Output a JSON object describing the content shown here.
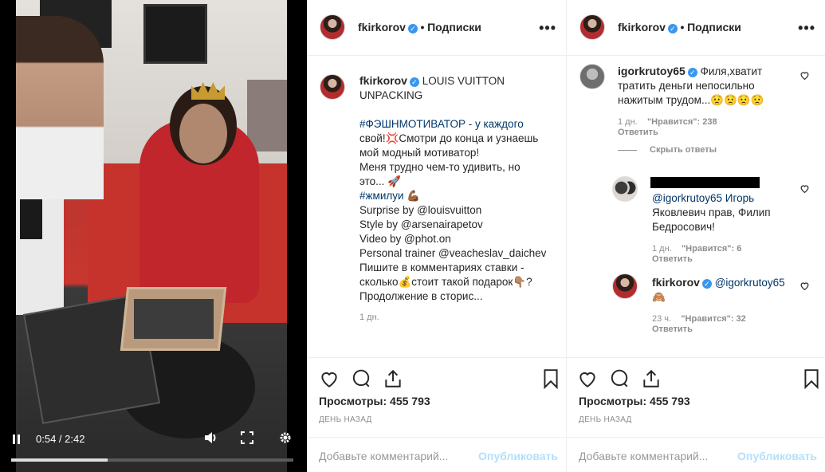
{
  "video": {
    "time": "0:54 / 2:42",
    "progress_fraction": 0.343,
    "icons": [
      "pause-icon",
      "volume-icon",
      "fullscreen-icon",
      "settings-icon"
    ]
  },
  "post_left": {
    "username": "fkirkorov",
    "follow_label": "Подписки",
    "dot": "•",
    "more": "•••",
    "caption": {
      "author": "fkirkorov",
      "lines": [
        "LOUIS VUITTON",
        "UNPACKING",
        "",
        "#ФЭШНМОТИВАТОР - у каждого",
        "свой!💢Смотри до конца и узнаешь",
        "мой модный мотиватор!",
        "Меня трудно чем-то удивить, но",
        "это... 🚀",
        "#жмилуи 💪🏾",
        "Surprise by @louisvuitton",
        "Style by @arsenairapetov",
        "Video by @phot.on",
        "Personal trainer @veacheslav_daichev",
        "Пишите в комментариях ставки -",
        "сколько💰стоит такой подарок👇🏽?",
        "Продолжение в сторис..."
      ],
      "time": "1 дн."
    },
    "views": "Просмотры: 455 793",
    "date": "ДЕНЬ НАЗАД",
    "comment_placeholder": "Добавьте комментарий...",
    "publish_label": "Опубликовать"
  },
  "post_right": {
    "username": "fkirkorov",
    "follow_label": "Подписки",
    "dot": "•",
    "more": "•••",
    "comments": [
      {
        "user": "igorkrutoy65",
        "lines": [
          "Филя,хватит",
          "тратить деньги непосильно",
          "нажитым трудом...😟😟😟😟"
        ],
        "time": "1 дн.",
        "likes": "\"Нравится\": 238",
        "reply": "Ответить"
      },
      {
        "user": "",
        "lines": [
          "@igorkrutoy65 Игорь",
          "Яковлевич прав, Филип",
          "Бедросович!"
        ],
        "time": "1 дн.",
        "likes": "\"Нравится\": 6",
        "reply": "Ответить"
      },
      {
        "user": "fkirkorov",
        "lines": [
          "@igorkrutoy65",
          "🙈"
        ],
        "time": "23 ч.",
        "likes": "\"Нравится\": 32",
        "reply": "Ответить"
      }
    ],
    "hide_replies": "Скрыть ответы",
    "views": "Просмотры: 455 793",
    "date": "ДЕНЬ НАЗАД",
    "comment_placeholder": "Добавьте комментарий...",
    "publish_label": "Опубликовать"
  },
  "colors": {
    "link": "#003569",
    "verified": "#3897f0",
    "muted": "#8e8e8e",
    "publish": "#b2dffc"
  }
}
